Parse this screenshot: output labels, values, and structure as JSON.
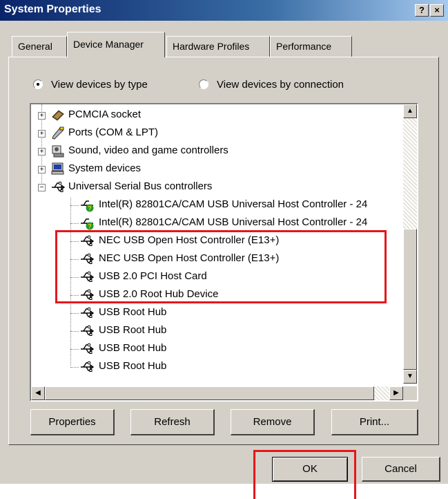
{
  "window": {
    "title": "System Properties",
    "help_glyph": "?",
    "close_glyph": "×"
  },
  "tabs": [
    {
      "label": "General",
      "active": false
    },
    {
      "label": "Device Manager",
      "active": true
    },
    {
      "label": "Hardware Profiles",
      "active": false
    },
    {
      "label": "Performance",
      "active": false
    }
  ],
  "view_options": {
    "by_type": {
      "label": "View devices by type",
      "selected": true
    },
    "by_connection": {
      "label": "View devices by connection",
      "selected": false
    }
  },
  "device_tree": {
    "categories": [
      {
        "label": "PCMCIA socket",
        "icon": "pcmcia-icon",
        "expander": "+"
      },
      {
        "label": "Ports (COM & LPT)",
        "icon": "port-icon",
        "expander": "+"
      },
      {
        "label": "Sound, video and game controllers",
        "icon": "sound-icon",
        "expander": "+"
      },
      {
        "label": "System devices",
        "icon": "computer-icon",
        "expander": "+"
      },
      {
        "label": "Universal Serial Bus controllers",
        "icon": "usb-icon",
        "expander": "−"
      }
    ],
    "usb_children": [
      {
        "label": "Intel(R) 82801CA/CAM USB Universal Host Controller - 24",
        "icon": "usb-warning-icon"
      },
      {
        "label": "Intel(R) 82801CA/CAM USB Universal Host Controller - 24",
        "icon": "usb-warning-icon"
      },
      {
        "label": "NEC USB Open Host Controller (E13+)",
        "icon": "usb-icon"
      },
      {
        "label": "NEC USB Open Host Controller (E13+)",
        "icon": "usb-icon"
      },
      {
        "label": "USB 2.0 PCI Host Card",
        "icon": "usb-icon"
      },
      {
        "label": "USB 2.0 Root Hub Device",
        "icon": "usb-icon"
      },
      {
        "label": "USB Root Hub",
        "icon": "usb-icon"
      },
      {
        "label": "USB Root Hub",
        "icon": "usb-icon"
      },
      {
        "label": "USB Root Hub",
        "icon": "usb-icon"
      },
      {
        "label": "USB Root Hub",
        "icon": "usb-icon"
      }
    ]
  },
  "scroll_glyphs": {
    "up": "▲",
    "down": "▼",
    "left": "◀",
    "right": "▶"
  },
  "actions": {
    "properties": "Properties",
    "refresh": "Refresh",
    "remove": "Remove",
    "print": "Print..."
  },
  "footer": {
    "ok": "OK",
    "cancel": "Cancel"
  },
  "colors": {
    "highlight_box": "#e4161b",
    "title_bar": "#0a246a",
    "dialog_face": "#d4d0c8"
  }
}
